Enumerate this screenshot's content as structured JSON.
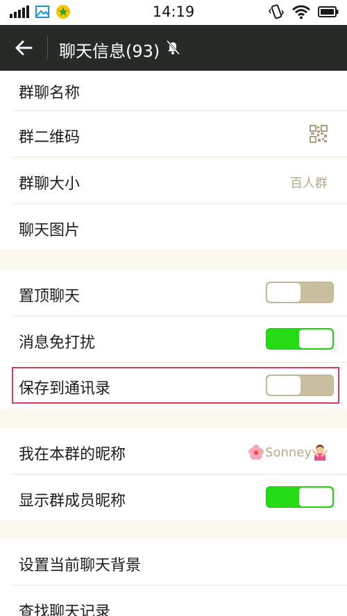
{
  "status_bar": {
    "time": "14:19"
  },
  "header": {
    "title": "聊天信息(93)"
  },
  "rows": {
    "group_name": {
      "label": "群聊名称"
    },
    "qr_code": {
      "label": "群二维码"
    },
    "group_size": {
      "label": "群聊大小",
      "value": "百人群"
    },
    "chat_images": {
      "label": "聊天图片"
    },
    "pin_chat": {
      "label": "置顶聊天",
      "state": "off"
    },
    "mute": {
      "label": "消息免打扰",
      "state": "on"
    },
    "save_contacts": {
      "label": "保存到通讯录",
      "state": "off"
    },
    "my_nickname": {
      "label": "我在本群的昵称",
      "value": "Sonney"
    },
    "show_nicknames": {
      "label": "显示群成员昵称",
      "state": "on"
    },
    "set_background": {
      "label": "设置当前聊天背景"
    },
    "search_history": {
      "label": "查找聊天记录"
    }
  },
  "colors": {
    "header_bg": "#272b28",
    "toggle_on": "#25db14",
    "toggle_off": "#c8bea0",
    "highlight": "#d83a5a"
  },
  "icons": [
    "signal-icon",
    "gallery-icon",
    "app-icon",
    "vibrate-icon",
    "wifi-icon",
    "battery-icon",
    "back-arrow-icon",
    "mute-bell-icon",
    "qr-code-icon",
    "flower-emoji-icon",
    "person-emoji-icon"
  ]
}
